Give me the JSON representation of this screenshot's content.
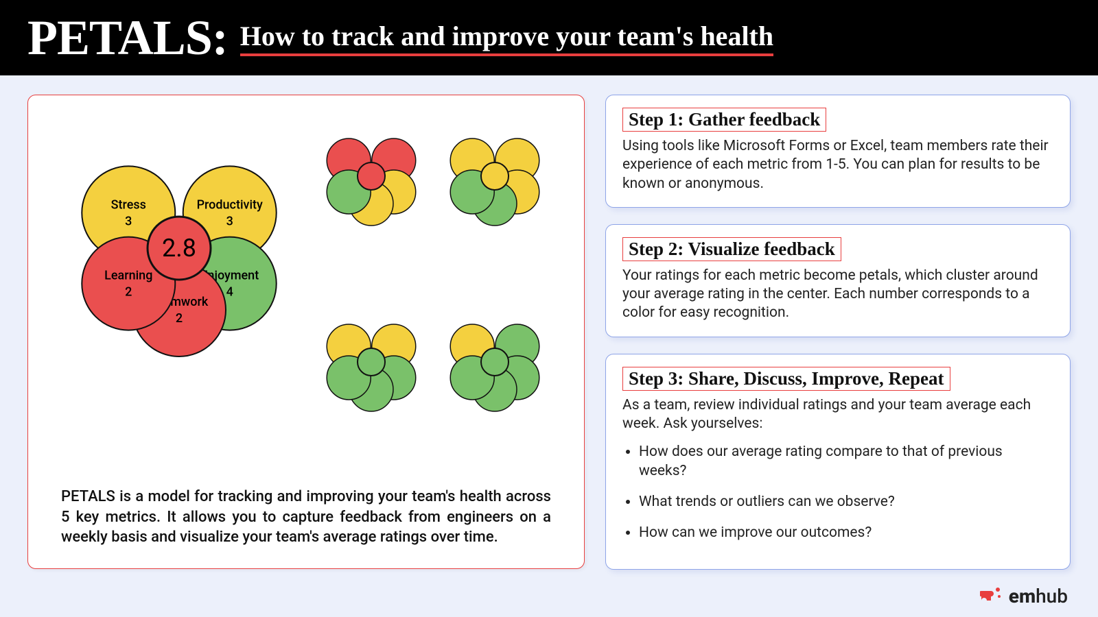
{
  "header": {
    "title": "PETALS:",
    "subtitle": "How to track and improve your team's health"
  },
  "colors": {
    "red": "#ea4f4f",
    "yellow": "#f4d03f",
    "green": "#7ac16a",
    "stroke": "#111"
  },
  "main_flower": {
    "center": "2.8",
    "center_color": "red",
    "petals": [
      {
        "label": "Stress",
        "value": "3",
        "color": "yellow",
        "angle": -55
      },
      {
        "label": "Productivity",
        "value": "3",
        "color": "yellow",
        "angle": 55
      },
      {
        "label": "Enjoyment",
        "value": "4",
        "color": "green",
        "angle": 125
      },
      {
        "label": "Teamwork",
        "value": "2",
        "color": "red",
        "angle": 180
      },
      {
        "label": "Learning",
        "value": "2",
        "color": "red",
        "angle": -125
      }
    ]
  },
  "small_flowers": [
    {
      "center": "red",
      "petals": [
        "red",
        "red",
        "yellow",
        "yellow",
        "green"
      ]
    },
    {
      "center": "yellow",
      "petals": [
        "yellow",
        "yellow",
        "yellow",
        "green",
        "green"
      ]
    },
    {
      "center": "green",
      "petals": [
        "yellow",
        "yellow",
        "green",
        "green",
        "green"
      ]
    },
    {
      "center": "green",
      "petals": [
        "yellow",
        "green",
        "green",
        "green",
        "green"
      ]
    }
  ],
  "description": "PETALS is a model for tracking and improving your team's health across 5 key metrics. It allows you to capture feedback from engineers on a weekly basis and visualize your team's average ratings over time.",
  "steps": [
    {
      "title": "Step 1: Gather feedback",
      "body": "Using tools like Microsoft Forms or Excel, team members rate their experience of each metric from 1-5. You can plan for results to be known or anonymous."
    },
    {
      "title": "Step 2: Visualize feedback",
      "body": "Your ratings for each metric become petals, which cluster around your average rating in the center. Each number corresponds to a color for easy recognition."
    },
    {
      "title": "Step 3: Share, Discuss, Improve, Repeat",
      "body": "As a team, review individual ratings and your team average each week. Ask yourselves:",
      "bullets": [
        "How does our average rating compare to that of previous weeks?",
        "What trends or outliers can we observe?",
        "How can we improve our outcomes?"
      ]
    }
  ],
  "footer": {
    "brand_bold": "em",
    "brand_rest": "hub"
  }
}
